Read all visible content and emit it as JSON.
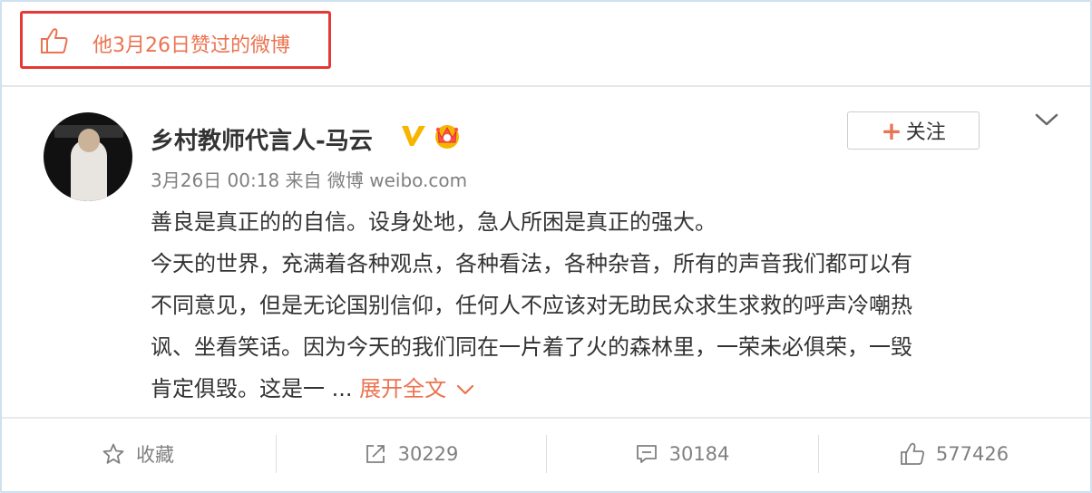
{
  "liked_header": {
    "icon": "thumbs-up-icon",
    "text": "他3月26日赞过的微博"
  },
  "post": {
    "author": "乡村教师代言人-马云",
    "verified_icon": "verified-v-icon",
    "vip_icon": "crown-badge-icon",
    "follow_label": "关注",
    "follow_plus": "+",
    "meta": "3月26日 00:18 来自 微博 weibo.com",
    "lines": [
      "善良是真正的的自信。设身处地，急人所困是真正的强大。",
      "今天的世界，充满着各种观点，各种看法，各种杂音，所有的声音我们都可以有",
      "不同意见，但是无论国别信仰，任何人不应该对无助民众求生求救的呼声冷嘲热",
      "讽、坐看笑话。因为今天的我们同在一片着了火的森林里，一荣未必俱荣，一毁"
    ],
    "last_line": "肯定俱毁。这是一 ...",
    "expand_label": "展开全文"
  },
  "actions": {
    "favorite_label": "收藏",
    "repost_count": "30229",
    "comment_count": "30184",
    "like_count": "577426"
  },
  "colors": {
    "accent": "#eb7350",
    "highlight_box": "#e53935",
    "verified": "#f7b500"
  }
}
